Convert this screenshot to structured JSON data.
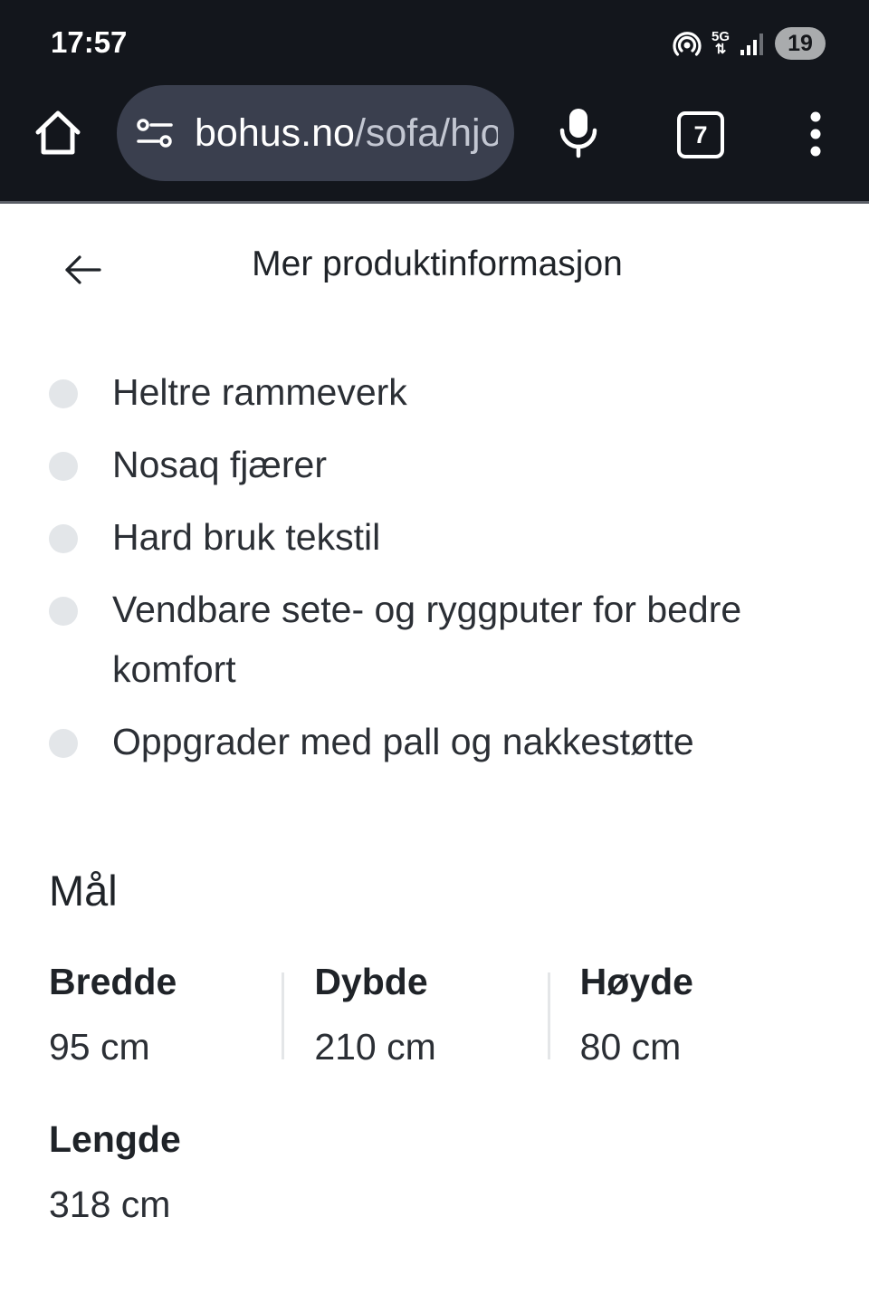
{
  "status_bar": {
    "time": "17:57",
    "network_label": "5G",
    "battery": "19"
  },
  "browser": {
    "url_host": "bohus.no",
    "url_path": "/sofa/hjo",
    "tab_count": "7"
  },
  "header": {
    "title": "Mer produktinformasjon"
  },
  "features": [
    "Heltre rammeverk",
    "Nosaq fjærer",
    "Hard bruk tekstil",
    "Vendbare sete- og ryggputer for bedre komfort",
    "Oppgrader med pall og nakkestøtte"
  ],
  "dimensions": {
    "title": "Mål",
    "items": [
      {
        "label": "Bredde",
        "value": "95 cm"
      },
      {
        "label": "Dybde",
        "value": "210 cm"
      },
      {
        "label": "Høyde",
        "value": "80 cm"
      },
      {
        "label": "Lengde",
        "value": "318 cm"
      }
    ]
  },
  "colors": {
    "browser_bar": "#13161c",
    "url_bar": "#3a3f4e",
    "bullet": "#e3e6e9",
    "text": "#1f2328"
  },
  "icons": {
    "home": "home-icon",
    "tune": "tune-icon",
    "mic": "mic-icon",
    "tabs": "tabs-icon",
    "menu": "more-vert-icon",
    "back": "arrow-left-icon"
  }
}
